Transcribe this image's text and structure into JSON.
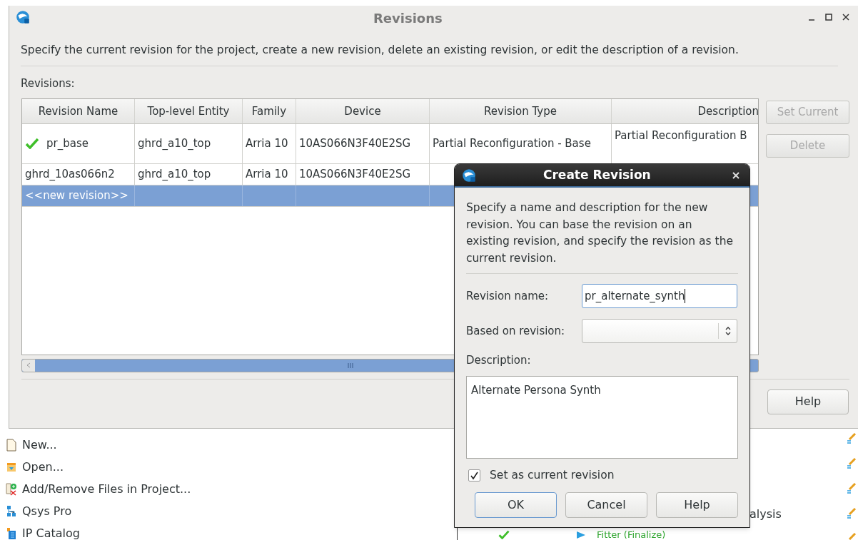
{
  "window": {
    "title": "Revisions",
    "instructions": "Specify the current revision for the project, create a new revision, delete an existing revision, or edit the description of a revision.",
    "list_label": "Revisions:"
  },
  "table": {
    "columns": [
      "Revision Name",
      "Top-level Entity",
      "Family",
      "Device",
      "Revision Type",
      "Description"
    ],
    "rows": [
      {
        "current": true,
        "selected": false,
        "cells": [
          "pr_base",
          "ghrd_a10_top",
          "Arria 10",
          "10AS066N3F40E2SG",
          "Partial Reconfiguration - Base",
          "Partial Reconfiguration B"
        ]
      },
      {
        "current": false,
        "selected": false,
        "cells": [
          "ghrd_10as066n2",
          "ghrd_a10_top",
          "Arria 10",
          "10AS066N3F40E2SG",
          "",
          ""
        ]
      },
      {
        "current": false,
        "selected": true,
        "cells": [
          "<<new revision>>",
          "",
          "",
          "",
          "",
          ""
        ]
      }
    ]
  },
  "side_buttons": [
    {
      "label": "Set Current",
      "disabled": true
    },
    {
      "label": "Delete",
      "disabled": true
    }
  ],
  "bottom_buttons": [
    {
      "label": "Help"
    }
  ],
  "dialog": {
    "title": "Create Revision",
    "intro": "Specify a name and description for the new revision. You can base the revision on an existing revision, and specify the revision as the current revision.",
    "name_label": "Revision name:",
    "name_value": "pr_alternate_synth",
    "based_label": "Based on revision:",
    "description_label": "Description:",
    "description_value": "Alternate Persona Synth",
    "set_current": {
      "label": "Set as current revision",
      "checked": true
    },
    "buttons": [
      {
        "label": "OK",
        "default": true
      },
      {
        "label": "Cancel",
        "default": false
      },
      {
        "label": "Help",
        "default": false
      }
    ]
  },
  "background": {
    "tasks": [
      {
        "kind": "new",
        "label": "New..."
      },
      {
        "kind": "open",
        "label": "Open..."
      },
      {
        "kind": "files",
        "label": "Add/Remove Files in Project..."
      },
      {
        "kind": "qsys",
        "label": "Qsys Pro"
      },
      {
        "kind": "ip",
        "label": "IP Catalog"
      }
    ],
    "flow_fragment": "alysis",
    "flow_step": "Fitter (Finalize)"
  }
}
